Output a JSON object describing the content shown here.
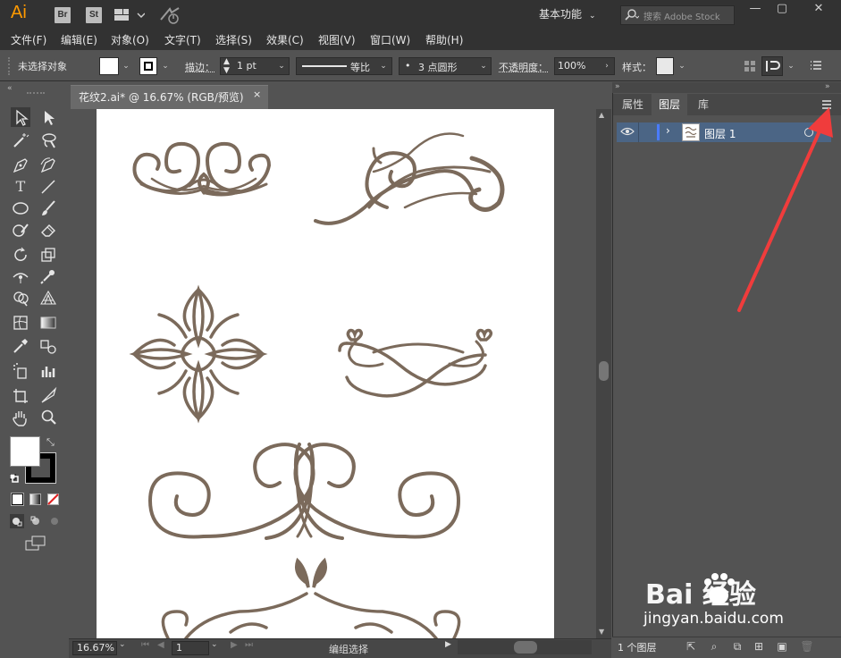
{
  "titlebar": {
    "logo": "Ai",
    "br": "Br",
    "st": "St",
    "workspace": "基本功能",
    "search_placeholder": "搜索 Adobe Stock"
  },
  "menu": [
    "文件(F)",
    "编辑(E)",
    "对象(O)",
    "文字(T)",
    "选择(S)",
    "效果(C)",
    "视图(V)",
    "窗口(W)",
    "帮助(H)"
  ],
  "control": {
    "no_selection": "未选择对象",
    "stroke_label": "描边：",
    "stroke_value": "1 pt",
    "profile": "等比",
    "brush": "3 点圆形",
    "brush_dot": "•",
    "opacity_label": "不透明度：",
    "opacity_value": "100%",
    "style_label": "样式："
  },
  "document": {
    "tab_label": "花纹2.ai* @ 16.67% (RGB/预览)",
    "close": "×"
  },
  "status": {
    "zoom": "16.67%",
    "page": "1",
    "tool": "编组选择"
  },
  "panel": {
    "tabs": [
      "属性",
      "图层",
      "库"
    ],
    "layer_name": "图层 1",
    "layer_count": "1 个图层"
  },
  "colors": {
    "ornament": "#7b6a5b",
    "accent_arrow": "#f03c3c",
    "selected_row": "#4b6585"
  },
  "watermark": {
    "brand": "Bai  经验",
    "url": "jingyan.baidu.com"
  }
}
